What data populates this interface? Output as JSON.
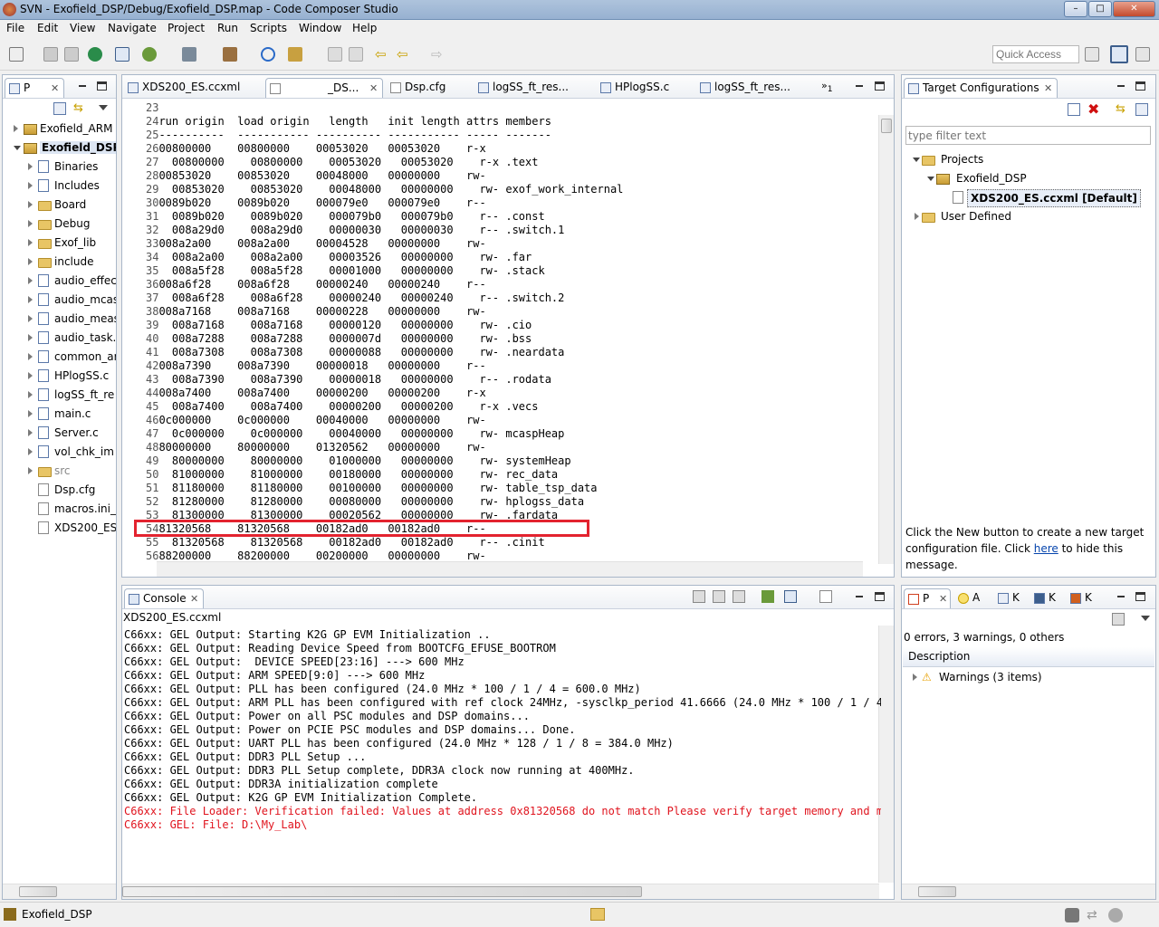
{
  "window": {
    "title": "SVN - Exofield_DSP/Debug/Exofield_DSP.map - Code Composer Studio"
  },
  "menu": [
    "File",
    "Edit",
    "View",
    "Navigate",
    "Project",
    "Run",
    "Scripts",
    "Window",
    "Help"
  ],
  "toolbar": {
    "quick_access": "Quick Access"
  },
  "explorer": {
    "tab": "P",
    "items": [
      {
        "label": "Exofield_ARM",
        "level": 0,
        "icon": "project-icon",
        "expand": "closed"
      },
      {
        "label": "Exofield_DSP",
        "level": 0,
        "icon": "project-icon",
        "expand": "open",
        "selected": true
      },
      {
        "label": "Binaries",
        "level": 1,
        "icon": "binaries-icon",
        "expand": "closed"
      },
      {
        "label": "Includes",
        "level": 1,
        "icon": "includes-icon",
        "expand": "closed"
      },
      {
        "label": "Board",
        "level": 1,
        "icon": "folder-icon",
        "expand": "closed"
      },
      {
        "label": "Debug",
        "level": 1,
        "icon": "folder-icon",
        "expand": "closed"
      },
      {
        "label": "Exof_lib",
        "level": 1,
        "icon": "folder-icon",
        "expand": "closed"
      },
      {
        "label": "include",
        "level": 1,
        "icon": "folder-icon",
        "expand": "closed"
      },
      {
        "label": "audio_effec",
        "level": 1,
        "icon": "c-file-icon",
        "expand": "closed"
      },
      {
        "label": "audio_mcas",
        "level": 1,
        "icon": "c-file-icon",
        "expand": "closed"
      },
      {
        "label": "audio_meas",
        "level": 1,
        "icon": "c-file-icon",
        "expand": "closed"
      },
      {
        "label": "audio_task.",
        "level": 1,
        "icon": "c-file-icon",
        "expand": "closed"
      },
      {
        "label": "common_ar",
        "level": 1,
        "icon": "c-file-icon",
        "expand": "closed"
      },
      {
        "label": "HPlogSS.c",
        "level": 1,
        "icon": "c-file-icon",
        "expand": "closed"
      },
      {
        "label": "logSS_ft_re",
        "level": 1,
        "icon": "c-file-icon",
        "expand": "closed"
      },
      {
        "label": "main.c",
        "level": 1,
        "icon": "c-file-icon",
        "expand": "closed"
      },
      {
        "label": "Server.c",
        "level": 1,
        "icon": "c-file-icon",
        "expand": "closed"
      },
      {
        "label": "vol_chk_im",
        "level": 1,
        "icon": "c-file-icon",
        "expand": "closed"
      },
      {
        "label": "src",
        "level": 1,
        "icon": "folder-icon",
        "expand": "closed",
        "dim": true
      },
      {
        "label": "Dsp.cfg",
        "level": 1,
        "icon": "file-icon",
        "expand": "none"
      },
      {
        "label": "macros.ini_",
        "level": 1,
        "icon": "file-icon",
        "expand": "none"
      },
      {
        "label": "XDS200_ES",
        "level": 1,
        "icon": "ccxml-icon",
        "expand": "none"
      }
    ]
  },
  "editor": {
    "tabs": [
      "XDS200_ES.ccxml",
      "_DS...",
      "Dsp.cfg",
      "logSS_ft_res...",
      "HPlogSS.c",
      "logSS_ft_res..."
    ],
    "overflow": "1",
    "lines": [
      {
        "n": "23",
        "text": ""
      },
      {
        "n": "24",
        "text": "run origin  load origin   length   init length attrs members"
      },
      {
        "n": "25",
        "text": "----------  ----------- ---------- ----------- ----- -------"
      },
      {
        "n": "26",
        "text": "00800000    00800000    00053020   00053020    r-x"
      },
      {
        "n": "27",
        "text": "  00800000    00800000    00053020   00053020    r-x .text"
      },
      {
        "n": "28",
        "text": "00853020    00853020    00048000   00000000    rw-"
      },
      {
        "n": "29",
        "text": "  00853020    00853020    00048000   00000000    rw- exof_work_internal"
      },
      {
        "n": "30",
        "text": "0089b020    0089b020    000079e0   000079e0    r--"
      },
      {
        "n": "31",
        "text": "  0089b020    0089b020    000079b0   000079b0    r-- .const"
      },
      {
        "n": "32",
        "text": "  008a29d0    008a29d0    00000030   00000030    r-- .switch.1"
      },
      {
        "n": "33",
        "text": "008a2a00    008a2a00    00004528   00000000    rw-"
      },
      {
        "n": "34",
        "text": "  008a2a00    008a2a00    00003526   00000000    rw- .far"
      },
      {
        "n": "35",
        "text": "  008a5f28    008a5f28    00001000   00000000    rw- .stack"
      },
      {
        "n": "36",
        "text": "008a6f28    008a6f28    00000240   00000240    r--"
      },
      {
        "n": "37",
        "text": "  008a6f28    008a6f28    00000240   00000240    r-- .switch.2"
      },
      {
        "n": "38",
        "text": "008a7168    008a7168    00000228   00000000    rw-"
      },
      {
        "n": "39",
        "text": "  008a7168    008a7168    00000120   00000000    rw- .cio"
      },
      {
        "n": "40",
        "text": "  008a7288    008a7288    0000007d   00000000    rw- .bss"
      },
      {
        "n": "41",
        "text": "  008a7308    008a7308    00000088   00000000    rw- .neardata"
      },
      {
        "n": "42",
        "text": "008a7390    008a7390    00000018   00000000    r--"
      },
      {
        "n": "43",
        "text": "  008a7390    008a7390    00000018   00000000    r-- .rodata"
      },
      {
        "n": "44",
        "text": "008a7400    008a7400    00000200   00000200    r-x"
      },
      {
        "n": "45",
        "text": "  008a7400    008a7400    00000200   00000200    r-x .vecs"
      },
      {
        "n": "46",
        "text": "0c000000    0c000000    00040000   00000000    rw-"
      },
      {
        "n": "47",
        "text": "  0c000000    0c000000    00040000   00000000    rw- mcaspHeap"
      },
      {
        "n": "48",
        "text": "80000000    80000000    01320562   00000000    rw-"
      },
      {
        "n": "49",
        "text": "  80000000    80000000    01000000   00000000    rw- systemHeap"
      },
      {
        "n": "50",
        "text": "  81000000    81000000    00180000   00000000    rw- rec_data"
      },
      {
        "n": "51",
        "text": "  81180000    81180000    00100000   00000000    rw- table_tsp_data"
      },
      {
        "n": "52",
        "text": "  81280000    81280000    00080000   00000000    rw- hplogss_data"
      },
      {
        "n": "53",
        "text": "  81300000    81300000    00020562   00000000    rw- .fardata"
      },
      {
        "n": "54",
        "text": "81320568    81320568    00182ad0   00182ad0    r--"
      },
      {
        "n": "55",
        "text": "  81320568    81320568    00182ad0   00182ad0    r-- .cinit"
      },
      {
        "n": "56",
        "text": "88200000    88200000    00200000   00000000    rw-"
      }
    ]
  },
  "target_config": {
    "tab": "Target Configurations",
    "filter_placeholder": "type filter text",
    "tree": {
      "projects": "Projects",
      "project": "Exofield_DSP",
      "config": "XDS200_ES.ccxml [Default]",
      "user_defined": "User Defined"
    },
    "hint_before": "Click the New button to create a new target configuration file. Click ",
    "hint_link": "here",
    "hint_after": " to hide this message."
  },
  "console": {
    "tab": "Console",
    "source": "XDS200_ES.ccxml",
    "lines": [
      {
        "text": "C66xx: GEL Output: Starting K2G GP EVM Initialization ..",
        "error": false
      },
      {
        "text": "C66xx: GEL Output: Reading Device Speed from BOOTCFG_EFUSE_BOOTROM",
        "error": false
      },
      {
        "text": "C66xx: GEL Output:  DEVICE SPEED[23:16] ---> 600 MHz",
        "error": false
      },
      {
        "text": "C66xx: GEL Output: ARM SPEED[9:0] ---> 600 MHz",
        "error": false
      },
      {
        "text": "C66xx: GEL Output: PLL has been configured (24.0 MHz * 100 / 1 / 4 = 600.0 MHz)",
        "error": false
      },
      {
        "text": "C66xx: GEL Output: ARM PLL has been configured with ref clock 24MHz, -sysclkp_period 41.6666 (24.0 MHz * 100 / 1 / 4 = 6",
        "error": false
      },
      {
        "text": "C66xx: GEL Output: Power on all PSC modules and DSP domains...",
        "error": false
      },
      {
        "text": "C66xx: GEL Output: Power on PCIE PSC modules and DSP domains... Done.",
        "error": false
      },
      {
        "text": "C66xx: GEL Output: UART PLL has been configured (24.0 MHz * 128 / 1 / 8 = 384.0 MHz)",
        "error": false
      },
      {
        "text": "C66xx: GEL Output: DDR3 PLL Setup ...",
        "error": false
      },
      {
        "text": "C66xx: GEL Output: DDR3 PLL Setup complete, DDR3A clock now running at 400MHz.",
        "error": false
      },
      {
        "text": "C66xx: GEL Output: DDR3A initialization complete",
        "error": false
      },
      {
        "text": "C66xx: GEL Output: K2G GP EVM Initialization Complete.",
        "error": false
      },
      {
        "text": "C66xx: File Loader: Verification failed: Values at address 0x81320568 do not match Please verify target memory and memor",
        "error": true
      },
      {
        "text": "C66xx: GEL: File: D:\\My_Lab\\",
        "error": true
      }
    ]
  },
  "problems": {
    "tabs": [
      "P",
      "A",
      "K",
      "K",
      "K"
    ],
    "summary": "0 errors, 3 warnings, 0 others",
    "column": "Description",
    "warnings": "Warnings (3 items)"
  },
  "statusbar": {
    "project": "Exofield_DSP"
  },
  "colors": {
    "highlight_box": "#e3232f",
    "error_text": "#e0141e",
    "link": "#0645ad"
  }
}
